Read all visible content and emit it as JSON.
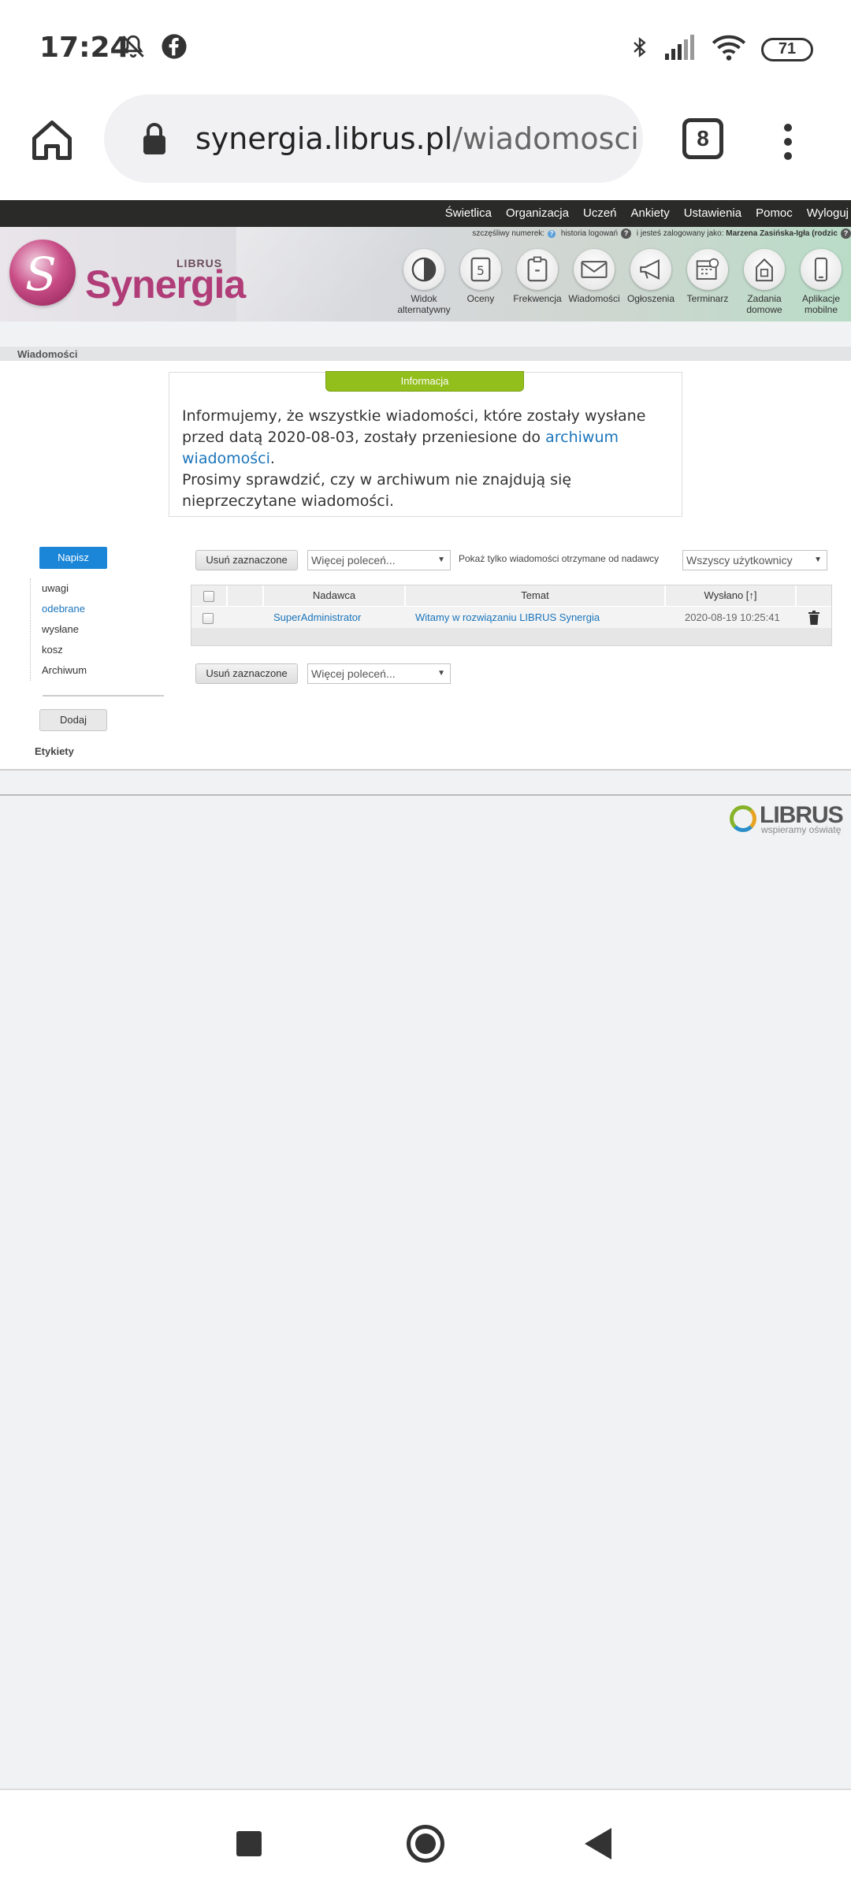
{
  "status_bar": {
    "time": "17:24",
    "battery": "71",
    "icons": [
      "bell-off-icon",
      "facebook-icon",
      "bluetooth-icon",
      "signal-icon",
      "wifi-icon",
      "battery-icon"
    ]
  },
  "browser": {
    "url_host": "synergia.librus.pl",
    "url_path": "/wiadomosci",
    "tab_count": "8"
  },
  "top_nav": [
    "Świetlica",
    "Organizacja",
    "Uczeń",
    "Ankiety",
    "Ustawienia",
    "Pomoc",
    "Wyloguj"
  ],
  "header": {
    "logo_librus": "LIBRUS",
    "logo_synergia": "Synergia",
    "lucky_number_label": "szczęśliwy numerek:",
    "login_history": "historia logowań",
    "logged_in_as": "i jesteś zalogowany jako:",
    "user_name": "Marzena Zasińska-Igła (rodzic",
    "nav_icons": [
      {
        "label": "Widok alternatywny",
        "icon": "contrast-icon"
      },
      {
        "label": "Oceny",
        "icon": "grades-icon"
      },
      {
        "label": "Frekwencja",
        "icon": "attendance-icon"
      },
      {
        "label": "Wiadomości",
        "icon": "envelope-icon"
      },
      {
        "label": "Ogłoszenia",
        "icon": "megaphone-icon"
      },
      {
        "label": "Terminarz",
        "icon": "calendar-icon"
      },
      {
        "label": "Zadania domowe",
        "icon": "homework-icon"
      },
      {
        "label": "Aplikacje mobilne",
        "icon": "phone-icon"
      }
    ]
  },
  "breadcrumb": "Wiadomości",
  "info": {
    "tab_title": "Informacja",
    "text_part1": "Informujemy, że wszystkie wiadomości, które zostały wysłane przed datą 2020-08-03, zostały przeniesione do ",
    "link_text": "archiwum wiadomości",
    "text_part2": ".",
    "text_line2": "Prosimy sprawdzić, czy w archiwum nie znajdują się nieprzeczytane wiadomości."
  },
  "sidebar": {
    "compose_label": "Napisz",
    "folders": [
      "uwagi",
      "odebrane",
      "wysłane",
      "kosz",
      "Archiwum"
    ],
    "active_folder": "odebrane",
    "add_label": "Dodaj",
    "labels_title": "Etykiety"
  },
  "toolbar": {
    "delete_selected": "Usuń zaznaczone",
    "more_commands": "Więcej poleceń...",
    "filter_label": "Pokaż tylko wiadomości otrzymane od nadawcy",
    "filter_value": "Wszyscy użytkownicy"
  },
  "table": {
    "columns": [
      "Nadawca",
      "Temat",
      "Wysłano [↑]"
    ],
    "rows": [
      {
        "sender": "SuperAdministrator",
        "subject": "Witamy w rozwiązaniu LIBRUS Synergia",
        "sent": "2020-08-19 10:25:41"
      }
    ]
  },
  "footer": {
    "brand": "LIBRUS",
    "tagline": "wspieramy oświatę"
  }
}
